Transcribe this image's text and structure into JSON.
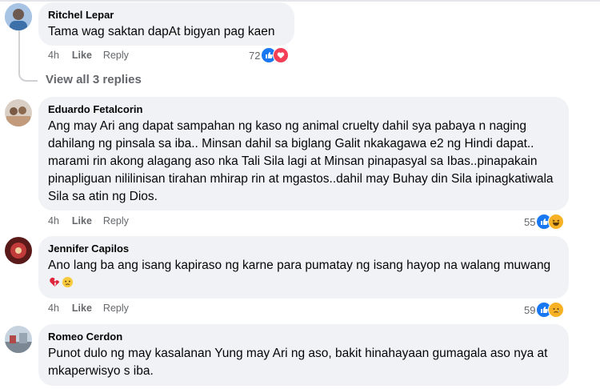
{
  "comments": [
    {
      "author": "Ritchel Lepar",
      "text": "Tama wag saktan dapAt bigyan pag kaen",
      "time": "4h",
      "like_label": "Like",
      "reply_label": "Reply",
      "reaction_count": "72",
      "reactions": [
        "like-icon",
        "love-icon"
      ]
    },
    {
      "author": "Eduardo Fetalcorin",
      "text": "Ang may Ari ang dapat sampahan ng kaso ng animal cruelty dahil sya pabaya n naging dahilang ng pinsala sa iba.. Minsan dahil sa biglang Galit nkakagawa e2 ng Hindi dapat.. marami rin akong alagang aso nka Tali Sila lagi at Minsan pinapasyal sa Ibas..pinapakain pinapliguan nililinisan tirahan mhirap rin at mgastos..dahil may Buhay din Sila ipinagkatiwala Sila sa atin ng Dios.",
      "time": "4h",
      "like_label": "Like",
      "reply_label": "Reply",
      "reaction_count": "55",
      "reactions": [
        "like-icon",
        "haha-icon"
      ]
    },
    {
      "author": "Jennifer Capilos",
      "text": "Ano lang ba ang isang kapiraso ng karne para pumatay ng isang hayop na walang muwang",
      "time": "4h",
      "like_label": "Like",
      "reply_label": "Reply",
      "reaction_count": "59",
      "reactions": [
        "like-icon",
        "sad-icon"
      ]
    },
    {
      "author": "Romeo Cerdon",
      "text": "Punot dulo ng may kasalanan Yung may Ari ng aso, bakit hinahayaan gumagala aso nya at mkaperwisyo s iba.",
      "time": "",
      "like_label": "",
      "reply_label": "",
      "reaction_count": "",
      "reactions": []
    }
  ],
  "view_replies": "View all 3 replies",
  "colors": {
    "like": "#1877f2",
    "love": "#f33e58",
    "bubble": "#f0f2f5",
    "meta": "#65676b"
  }
}
